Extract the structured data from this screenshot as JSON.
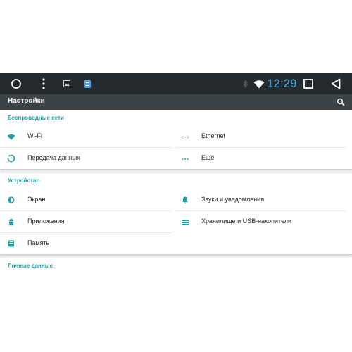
{
  "status_bar": {
    "time": "12:29",
    "nav": {
      "home_icon": "circle-home-icon",
      "menu_icon": "vertical-dots-icon",
      "back_icon": "triangle-back-icon",
      "recents_icon": "square-recents-icon"
    }
  },
  "toolbar": {
    "title": "Настройки",
    "search_icon": "search-icon"
  },
  "sections": {
    "wireless": {
      "title": "Беспроводные сети",
      "items": [
        {
          "label": "Wi-Fi",
          "icon": "wifi-icon"
        },
        {
          "label": "Ethernet",
          "icon": "ethernet-icon"
        },
        {
          "label": "Передача данных",
          "icon": "data-usage-icon"
        },
        {
          "label": "Ещё",
          "icon": "more-icon"
        }
      ]
    },
    "device": {
      "title": "Устройство",
      "items": [
        {
          "label": "Экран",
          "icon": "brightness-icon"
        },
        {
          "label": "Звуки и уведомления",
          "icon": "bell-icon"
        },
        {
          "label": "Приложения",
          "icon": "android-icon"
        },
        {
          "label": "Хранилище и USB-накопители",
          "icon": "storage-icon"
        },
        {
          "label": "Память",
          "icon": "memory-icon"
        }
      ]
    },
    "personal": {
      "title": "Личные данные"
    }
  },
  "colors": {
    "accent": "#1e9fa3",
    "statusbar": "#252a2e",
    "toolbar": "#3c4346",
    "time": "#4fb3e8"
  }
}
